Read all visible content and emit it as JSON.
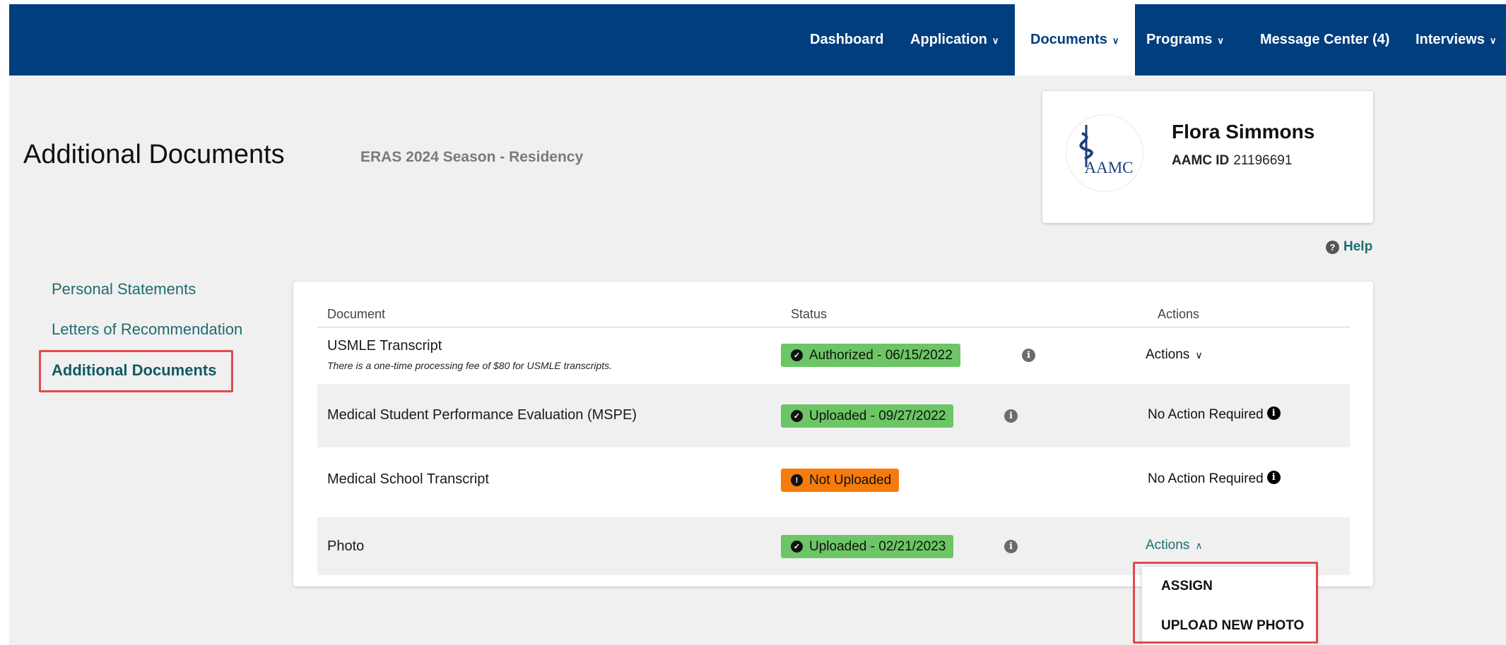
{
  "nav": {
    "dashboard": "Dashboard",
    "application": "Application",
    "documents": "Documents",
    "programs": "Programs",
    "message_center": "Message Center (4)",
    "interviews": "Interviews"
  },
  "header": {
    "title": "Additional Documents",
    "season": "ERAS 2024 Season - Residency"
  },
  "profile": {
    "logo_text": "AAMC",
    "name": "Flora Simmons",
    "id_label": "AAMC ID",
    "id_value": "21196691"
  },
  "help_label": "Help",
  "sidebar": {
    "items": [
      {
        "label": "Personal Statements"
      },
      {
        "label": "Letters of Recommendation"
      },
      {
        "label": "Additional Documents"
      }
    ]
  },
  "table": {
    "headers": {
      "document": "Document",
      "status": "Status",
      "actions": "Actions"
    },
    "rows": [
      {
        "document": "USMLE Transcript",
        "note": "There is a one-time processing fee of $80 for USMLE transcripts.",
        "status": "Authorized - 06/15/2022",
        "action": "Actions"
      },
      {
        "document": "Medical Student Performance Evaluation (MSPE)",
        "status": "Uploaded - 09/27/2022",
        "action": "No Action Required"
      },
      {
        "document": "Medical School Transcript",
        "status": "Not Uploaded",
        "action": "No Action Required"
      },
      {
        "document": "Photo",
        "status": "Uploaded - 02/21/2023",
        "action": "Actions"
      }
    ]
  },
  "dropdown": {
    "items": [
      {
        "label": "ASSIGN"
      },
      {
        "label": "UPLOAD NEW PHOTO"
      }
    ]
  },
  "colors": {
    "nav_bg": "#003e7e",
    "teal_link": "#1f6c6f",
    "status_green": "#6cc665",
    "status_orange": "#f57c0c",
    "highlight_red": "#e5484d"
  },
  "icons": {
    "chevron_down": "chevron-down-icon",
    "chevron_up": "chevron-up-icon",
    "help": "question-circle-icon",
    "check": "check-circle-icon",
    "alert": "exclamation-circle-icon",
    "info": "info-circle-icon"
  }
}
